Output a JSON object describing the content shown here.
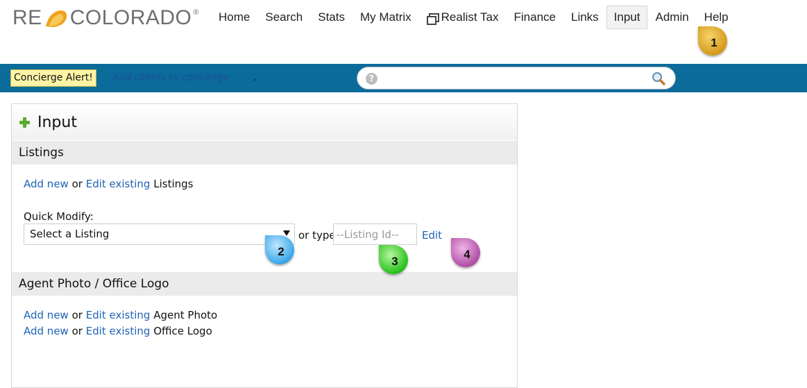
{
  "header": {
    "logo": {
      "left": "RE",
      "right": "COLORADO",
      "registered": "®"
    },
    "nav": [
      {
        "label": "Home",
        "active": false
      },
      {
        "label": "Search",
        "active": false
      },
      {
        "label": "Stats",
        "active": false
      },
      {
        "label": "My Matrix",
        "active": false
      },
      {
        "label": "Realist Tax",
        "active": false,
        "icon": "window-icon"
      },
      {
        "label": "Finance",
        "active": false
      },
      {
        "label": "Links",
        "active": false
      },
      {
        "label": "Input",
        "active": true
      },
      {
        "label": "Admin",
        "active": false
      },
      {
        "label": "Help",
        "active": false
      }
    ]
  },
  "callouts": [
    "1",
    "2",
    "3",
    "4"
  ],
  "alert_bar": {
    "alert_label": "Concierge Alert!",
    "alert_link": "Add clients to concierge",
    "alert_suffix": ".",
    "search_placeholder": "",
    "help_glyph": "?"
  },
  "panel": {
    "title": "Input",
    "listings": {
      "heading": "Listings",
      "add_new": "Add new",
      "or": "or",
      "edit_existing": "Edit existing",
      "noun": "Listings",
      "quick_modify_label": "Quick Modify:",
      "select_value": "Select a Listing",
      "or_type": "or type",
      "listing_id_placeholder": "--Listing Id--",
      "edit": "Edit"
    },
    "photo": {
      "heading": "Agent Photo / Office Logo",
      "rows": [
        {
          "add_new": "Add new",
          "or": "or",
          "edit_existing": "Edit existing",
          "noun": "Agent Photo"
        },
        {
          "add_new": "Add new",
          "or": "or",
          "edit_existing": "Edit existing",
          "noun": "Office Logo"
        }
      ]
    }
  },
  "colors": {
    "bar": "#0b6b9a",
    "link": "#1f64b4",
    "alert_bg": "#fdf4a6"
  }
}
